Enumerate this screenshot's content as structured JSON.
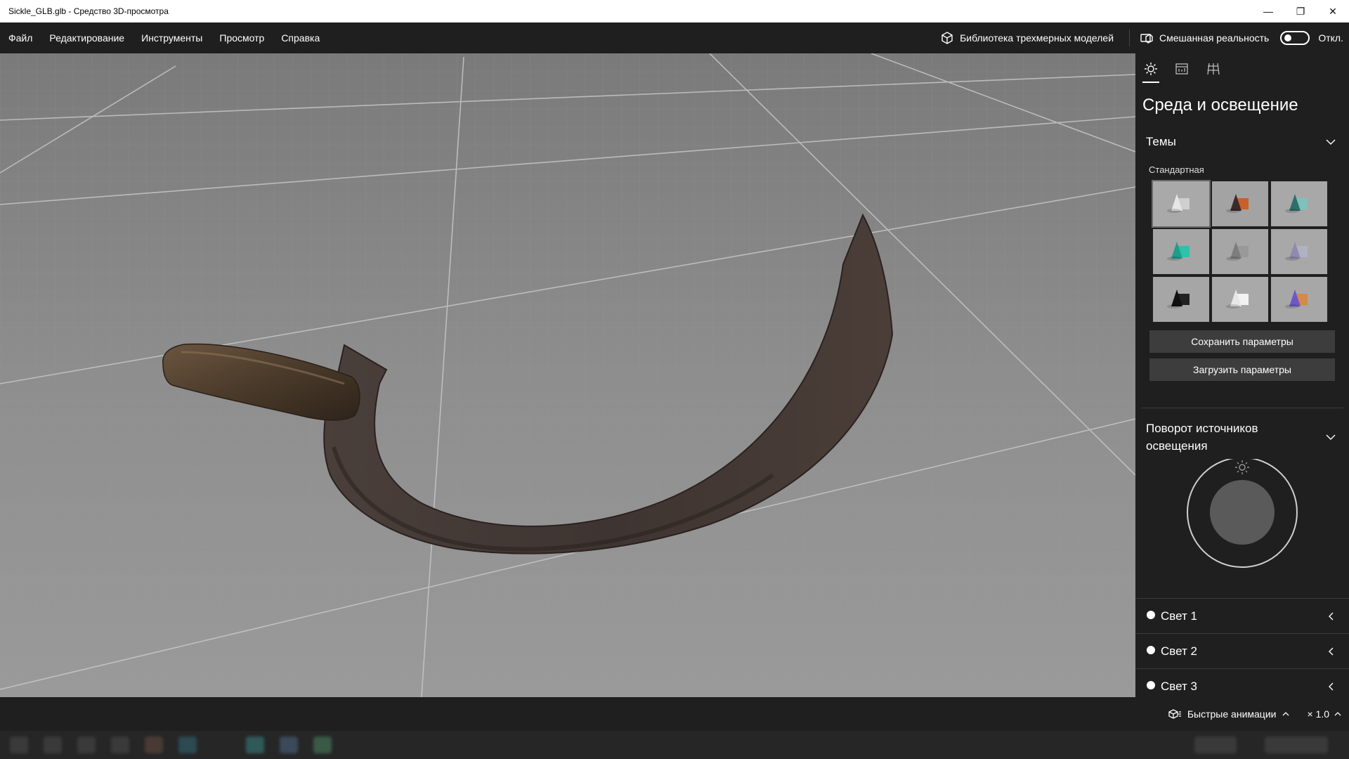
{
  "window": {
    "title": "Sickle_GLB.glb - Средство 3D-просмотра",
    "minimize_glyph": "—",
    "restore_glyph": "❐",
    "close_glyph": "✕"
  },
  "menu": {
    "items": [
      "Файл",
      "Редактирование",
      "Инструменты",
      "Просмотр",
      "Справка"
    ],
    "library_label": "Библиотека трехмерных моделей",
    "mixed_reality_label": "Смешанная реальность",
    "mixed_reality_state": "Откл."
  },
  "panel": {
    "tabs": [
      {
        "icon": "sun-icon",
        "active": true
      },
      {
        "icon": "stats-icon",
        "active": false
      },
      {
        "icon": "grid-icon",
        "active": false
      }
    ],
    "title": "Среда и освещение",
    "themes": {
      "header": "Темы",
      "subheader": "Стандартная",
      "thumbnails": [
        {
          "name": "theme-1",
          "bg": "#a9a9a9",
          "accent": "#e6e6e6",
          "accent2": "#cfcfcf",
          "selected": true
        },
        {
          "name": "theme-2",
          "bg": "#a3a3a3",
          "accent": "#3a2a28",
          "accent2": "#c8602a",
          "selected": false
        },
        {
          "name": "theme-3",
          "bg": "#a8a8a8",
          "accent": "#2f6e6a",
          "accent2": "#7ec2bb",
          "selected": false
        },
        {
          "name": "theme-4",
          "bg": "#a6a6a6",
          "accent": "#1f9c8a",
          "accent2": "#2ec2a8",
          "selected": false
        },
        {
          "name": "theme-5",
          "bg": "#a6a6a6",
          "accent": "#7d7d7d",
          "accent2": "#999999",
          "selected": false
        },
        {
          "name": "theme-6",
          "bg": "#a8a8a8",
          "accent": "#8e8ab0",
          "accent2": "#b1b1c4",
          "selected": false
        },
        {
          "name": "theme-7",
          "bg": "#a6a6a6",
          "accent": "#111111",
          "accent2": "#222222",
          "selected": false
        },
        {
          "name": "theme-8",
          "bg": "#a9a9a9",
          "accent": "#e7e7e7",
          "accent2": "#f2f2f2",
          "selected": false
        },
        {
          "name": "theme-9",
          "bg": "#a7a7a7",
          "accent": "#6f56c8",
          "accent2": "#d48a4a",
          "selected": false
        }
      ],
      "save_label": "Сохранить параметры",
      "load_label": "Загрузить параметры"
    },
    "rotation": {
      "header": "Поворот источников освещения"
    },
    "lights": [
      {
        "label": "Свет 1"
      },
      {
        "label": "Свет 2"
      },
      {
        "label": "Свет 3"
      }
    ]
  },
  "status": {
    "animations_label": "Быстрые анимации",
    "speed_label": "× 1.0"
  },
  "colors": {
    "chrome": "#1f1f1f",
    "viewport_bg": "#8a8a8a",
    "button_bg": "#3d3d3d"
  }
}
